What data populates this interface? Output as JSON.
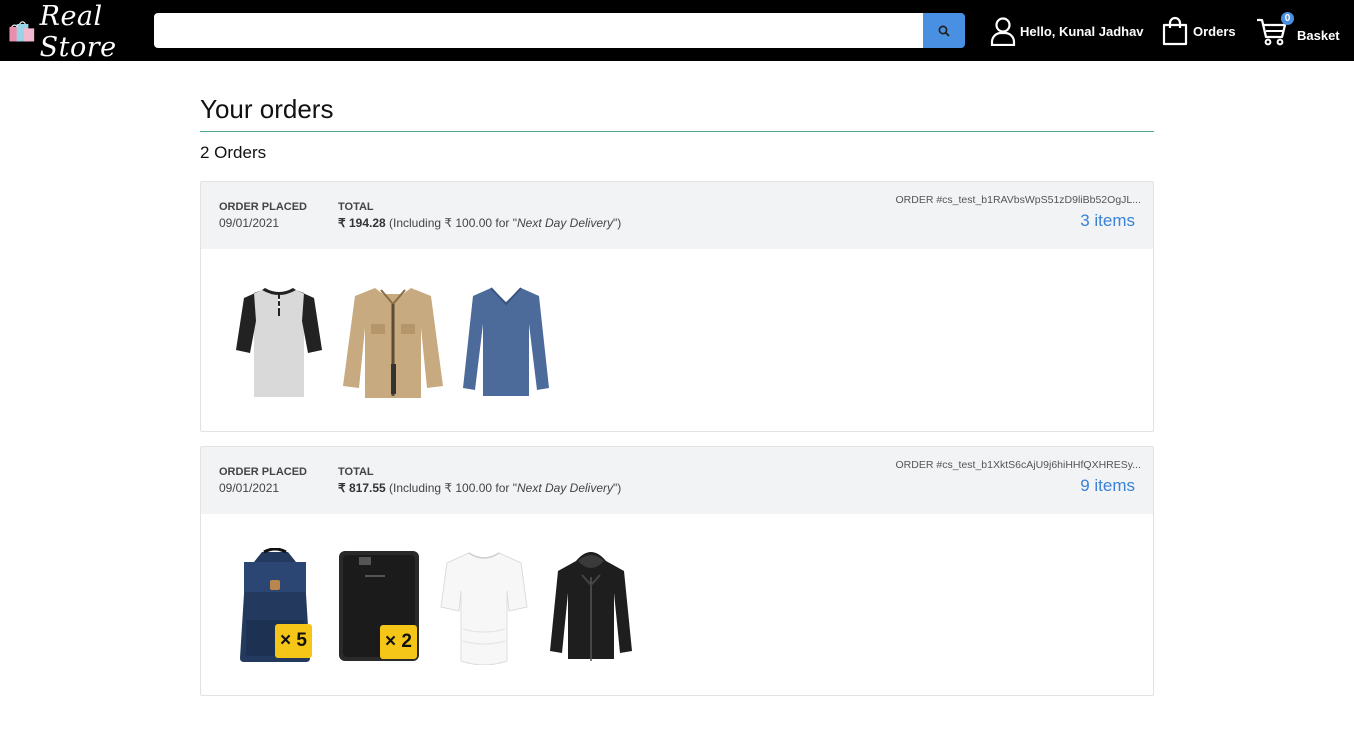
{
  "header": {
    "logo_text": "Real Store",
    "search": {
      "value": "",
      "placeholder": ""
    },
    "user_label": "Hello, Kunal Jadhav",
    "orders_label": "Orders",
    "basket_label": "Basket",
    "basket_count": "0"
  },
  "page": {
    "title": "Your orders",
    "order_count": "2 Orders"
  },
  "orders": [
    {
      "placed_label": "ORDER PLACED",
      "placed_date": "09/01/2021",
      "total_label": "TOTAL",
      "total_amount": "₹ 194.28",
      "total_note_prefix": " (Including ₹ 100.00 for \"",
      "delivery": "Next Day Delivery",
      "total_note_suffix": "\")",
      "order_id": "ORDER #cs_test_b1RAVbsWpS51zD9liBb52OgJL...",
      "items_link": "3 items",
      "products": [
        {
          "icon": "henley-tshirt-image"
        },
        {
          "icon": "khaki-jacket-image"
        },
        {
          "icon": "blue-sweater-image"
        }
      ]
    },
    {
      "placed_label": "ORDER PLACED",
      "placed_date": "09/01/2021",
      "total_label": "TOTAL",
      "total_amount": "₹ 817.55",
      "total_note_prefix": " (Including ₹ 100.00 for \"",
      "delivery": "Next Day Delivery",
      "total_note_suffix": "\")",
      "order_id": "ORDER #cs_test_b1XktS6cAjU9j6hiHHfQXHRESy...",
      "items_link": "9 items",
      "products": [
        {
          "icon": "backpack-image",
          "qty": "× 5"
        },
        {
          "icon": "hard-drive-image",
          "qty": "× 2"
        },
        {
          "icon": "white-top-image"
        },
        {
          "icon": "black-leather-jacket-image"
        }
      ]
    }
  ],
  "colors": {
    "header_bg": "#000000",
    "accent": "#4a90e2",
    "link": "#3b82d6",
    "badge": "#f5c518",
    "title_rule": "#4fa88e"
  }
}
